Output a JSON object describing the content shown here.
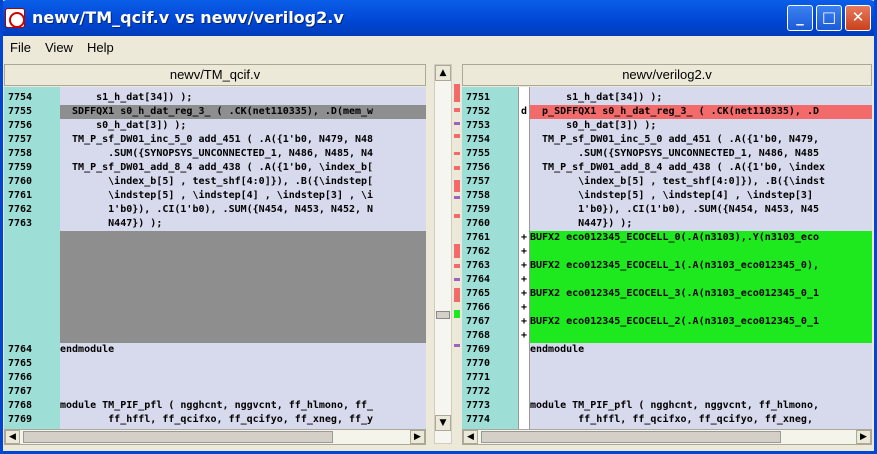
{
  "window": {
    "title": "newv/TM_qcif.v vs newv/verilog2.v"
  },
  "titlebar_icons": [
    "minimize-icon",
    "maximize-icon",
    "close-icon"
  ],
  "menu": [
    "File",
    "View",
    "Help"
  ],
  "colors": {
    "changed": "#f36a6a",
    "added": "#1ee81e",
    "deleted_gray": "#8e8e8e",
    "gutter": "#9ddfd7",
    "code_bg": "#d7d9ec"
  },
  "left": {
    "header": "newv/TM_qcif.v",
    "lines": [
      {
        "num": "7754",
        "text": "      s1_h_dat[34]) );"
      },
      {
        "num": "7755",
        "text": "  SDFFQX1 s0_h_dat_reg_3_ ( .CK(net110335), .D(mem_w"
      },
      {
        "num": "7756",
        "text": "      s0_h_dat[3]) );"
      },
      {
        "num": "7757",
        "text": "  TM_P_sf_DW01_inc_5_0 add_451 ( .A({1'b0, N479, N48"
      },
      {
        "num": "7758",
        "text": "        .SUM({SYNOPSYS_UNCONNECTED_1, N486, N485, N4"
      },
      {
        "num": "7759",
        "text": "  TM_P_sf_DW01_add_8_4 add_438 ( .A({1'b0, \\index_b["
      },
      {
        "num": "7760",
        "text": "        \\index_b[5] , test_shf[4:0]}), .B({\\indstep["
      },
      {
        "num": "7761",
        "text": "        \\indstep[5] , \\indstep[4] , \\indstep[3] , \\i"
      },
      {
        "num": "7762",
        "text": "        1'b0}), .CI(1'b0), .SUM({N454, N453, N452, N"
      },
      {
        "num": "7763",
        "text": "        N447}) );"
      },
      {
        "num": "7764",
        "text": "endmodule"
      },
      {
        "num": "7765",
        "text": ""
      },
      {
        "num": "7766",
        "text": ""
      },
      {
        "num": "7767",
        "text": ""
      },
      {
        "num": "7768",
        "text": "module TM_PIF_pfl ( ngghcnt, nggvcnt, ff_hlmono, ff_"
      },
      {
        "num": "7769",
        "text": "        ff_hffl, ff_qcifxo, ff_qcifyo, ff_xneg, ff_y"
      }
    ]
  },
  "right": {
    "header": "newv/verilog2.v",
    "lines": [
      {
        "num": "7751",
        "mark": "",
        "text": "      s1_h_dat[34]) );"
      },
      {
        "num": "7752",
        "mark": "d",
        "text": "  p_SDFFQX1 s0_h_dat_reg_3_ ( .CK(net110335), .D"
      },
      {
        "num": "7753",
        "mark": "",
        "text": "      s0_h_dat[3]) );"
      },
      {
        "num": "7754",
        "mark": "",
        "text": "  TM_P_sf_DW01_inc_5_0 add_451 ( .A({1'b0, N479,"
      },
      {
        "num": "7755",
        "mark": "",
        "text": "        .SUM({SYNOPSYS_UNCONNECTED_1, N486, N485"
      },
      {
        "num": "7756",
        "mark": "",
        "text": "  TM_P_sf_DW01_add_8_4 add_438 ( .A({1'b0, \\index"
      },
      {
        "num": "7757",
        "mark": "",
        "text": "        \\index_b[5] , test_shf[4:0]}), .B({\\indst"
      },
      {
        "num": "7758",
        "mark": "",
        "text": "        \\indstep[5] , \\indstep[4] , \\indstep[3]"
      },
      {
        "num": "7759",
        "mark": "",
        "text": "        1'b0}), .CI(1'b0), .SUM({N454, N453, N45"
      },
      {
        "num": "7760",
        "mark": "",
        "text": "        N447}) );"
      },
      {
        "num": "7761",
        "mark": "+",
        "text": "BUFX2 eco012345_ECOCELL_0(.A(n3103),.Y(n3103_eco"
      },
      {
        "num": "7762",
        "mark": "+",
        "text": ""
      },
      {
        "num": "7763",
        "mark": "+",
        "text": "BUFX2 eco012345_ECOCELL_1(.A(n3103_eco012345_0),"
      },
      {
        "num": "7764",
        "mark": "+",
        "text": ""
      },
      {
        "num": "7765",
        "mark": "+",
        "text": "BUFX2 eco012345_ECOCELL_3(.A(n3103_eco012345_0_1"
      },
      {
        "num": "7766",
        "mark": "+",
        "text": ""
      },
      {
        "num": "7767",
        "mark": "+",
        "text": "BUFX2 eco012345_ECOCELL_2(.A(n3103_eco012345_0_1"
      },
      {
        "num": "7768",
        "mark": "+",
        "text": ""
      },
      {
        "num": "7769",
        "mark": "",
        "text": "endmodule"
      },
      {
        "num": "7770",
        "mark": "",
        "text": ""
      },
      {
        "num": "7771",
        "mark": "",
        "text": ""
      },
      {
        "num": "7772",
        "mark": "",
        "text": ""
      },
      {
        "num": "7773",
        "mark": "",
        "text": "module TM_PIF_pfl ( ngghcnt, nggvcnt, ff_hlmono,"
      },
      {
        "num": "7774",
        "mark": "",
        "text": "        ff_hffl, ff_qcifxo, ff_qcifyo, ff_xneg,"
      }
    ]
  }
}
